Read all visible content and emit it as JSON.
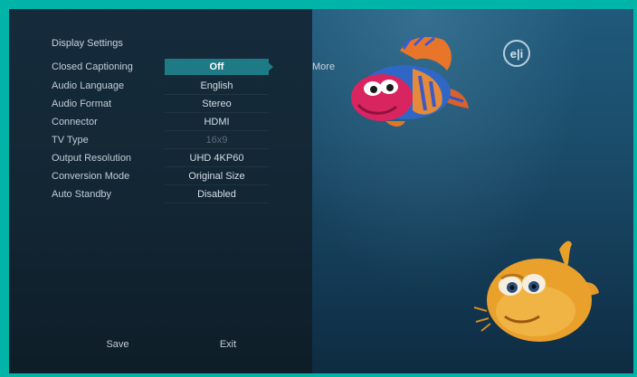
{
  "menu": {
    "title": "Display Settings",
    "more_label": "More",
    "rows": [
      {
        "label": "Closed Captioning",
        "value": "Off"
      },
      {
        "label": "Audio Language",
        "value": "English"
      },
      {
        "label": "Audio Format",
        "value": "Stereo"
      },
      {
        "label": "Connector",
        "value": "HDMI"
      },
      {
        "label": "TV Type",
        "value": "16x9"
      },
      {
        "label": "Output Resolution",
        "value": "UHD 4KP60"
      },
      {
        "label": "Conversion Mode",
        "value": "Original Size"
      },
      {
        "label": "Auto Standby",
        "value": "Disabled"
      }
    ]
  },
  "buttons": {
    "save": "Save",
    "exit": "Exit"
  },
  "icons": {
    "logo": "channel-logo-icon",
    "fish1": "pink-fish-icon",
    "fish2": "orange-pufferfish-icon"
  },
  "colors": {
    "frame": "#00b4a8",
    "selected": "#1e7a84",
    "background": "#1a4a67"
  }
}
